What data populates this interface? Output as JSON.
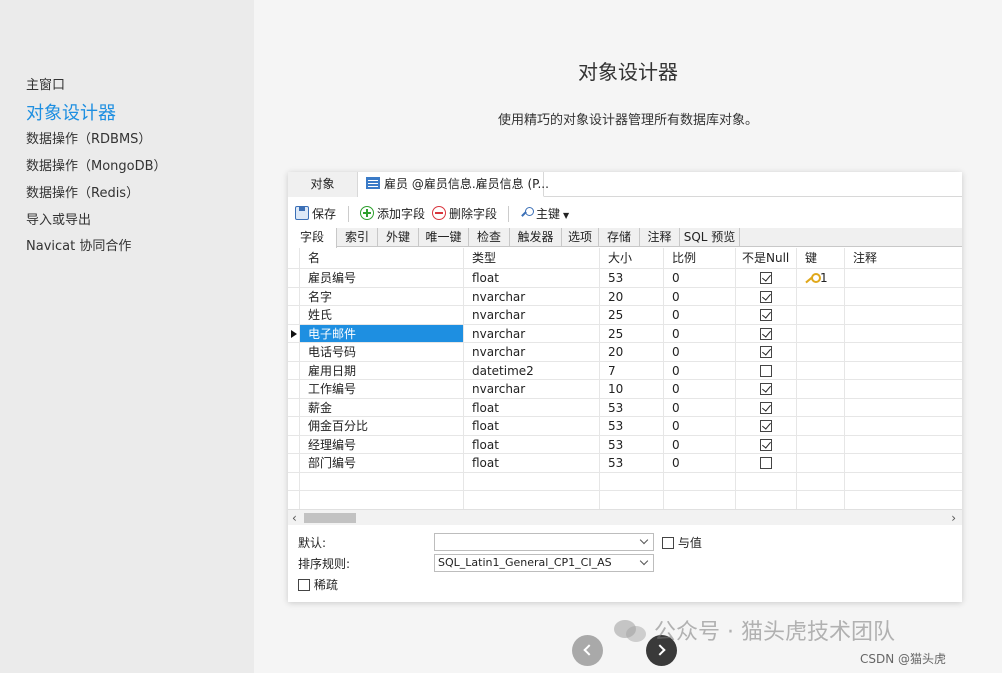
{
  "sidebar": {
    "items": [
      {
        "label": "主窗口"
      },
      {
        "label": "对象设计器"
      },
      {
        "label": "数据操作（RDBMS）"
      },
      {
        "label": "数据操作（MongoDB）"
      },
      {
        "label": "数据操作（Redis）"
      },
      {
        "label": "导入或导出"
      },
      {
        "label": "Navicat 协同合作"
      }
    ]
  },
  "main": {
    "title": "对象设计器",
    "subtitle": "使用精巧的对象设计器管理所有数据库对象。"
  },
  "window": {
    "tabs": [
      "对象",
      "雇员 @雇员信息.雇员信息 (P..."
    ],
    "toolbar": {
      "save": "保存",
      "add_field": "添加字段",
      "delete_field": "删除字段",
      "primary_key": "主键"
    },
    "subtabs": [
      "字段",
      "索引",
      "外键",
      "唯一键",
      "检查",
      "触发器",
      "选项",
      "存储",
      "注释",
      "SQL 预览"
    ],
    "columns": [
      "名",
      "类型",
      "大小",
      "比例",
      "不是Null",
      "键",
      "注释"
    ],
    "rows": [
      {
        "name": "雇员编号",
        "type": "float",
        "size": "53",
        "scale": "0",
        "notnull": true,
        "key": "1"
      },
      {
        "name": "名字",
        "type": "nvarchar",
        "size": "20",
        "scale": "0",
        "notnull": true,
        "key": ""
      },
      {
        "name": "姓氏",
        "type": "nvarchar",
        "size": "25",
        "scale": "0",
        "notnull": true,
        "key": ""
      },
      {
        "name": "电子邮件",
        "type": "nvarchar",
        "size": "25",
        "scale": "0",
        "notnull": true,
        "key": ""
      },
      {
        "name": "电话号码",
        "type": "nvarchar",
        "size": "20",
        "scale": "0",
        "notnull": true,
        "key": ""
      },
      {
        "name": "雇用日期",
        "type": "datetime2",
        "size": "7",
        "scale": "0",
        "notnull": false,
        "key": ""
      },
      {
        "name": "工作编号",
        "type": "nvarchar",
        "size": "10",
        "scale": "0",
        "notnull": true,
        "key": ""
      },
      {
        "name": "薪金",
        "type": "float",
        "size": "53",
        "scale": "0",
        "notnull": true,
        "key": ""
      },
      {
        "name": "佣金百分比",
        "type": "float",
        "size": "53",
        "scale": "0",
        "notnull": true,
        "key": ""
      },
      {
        "name": "经理编号",
        "type": "float",
        "size": "53",
        "scale": "0",
        "notnull": true,
        "key": ""
      },
      {
        "name": "部门编号",
        "type": "float",
        "size": "53",
        "scale": "0",
        "notnull": false,
        "key": ""
      }
    ],
    "properties": {
      "default_label": "默认:",
      "default_value": "",
      "with_value_label": "与值",
      "collation_label": "排序规则:",
      "collation_value": "SQL_Latin1_General_CP1_CI_AS",
      "sparse_label": "稀疏"
    }
  },
  "watermark": {
    "text": "公众号 · 猫头虎技术团队",
    "csdn": "CSDN @猫头虎"
  }
}
